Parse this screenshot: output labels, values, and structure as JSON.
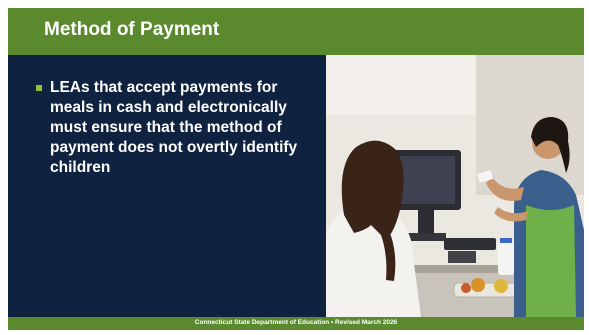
{
  "slide": {
    "title": "Method of Payment",
    "bullets": [
      "LEAs that accept payments for meals in cash and electronically must ensure that the method of payment does not overtly identify children"
    ],
    "footer": "Connecticut State Department of Education • Revised March 2026"
  },
  "colors": {
    "accent_green": "#5b8a2e",
    "panel_navy": "#0f2240",
    "bullet_green": "#8cc63f"
  },
  "icons": {
    "bullet": "square-bullet-icon"
  }
}
